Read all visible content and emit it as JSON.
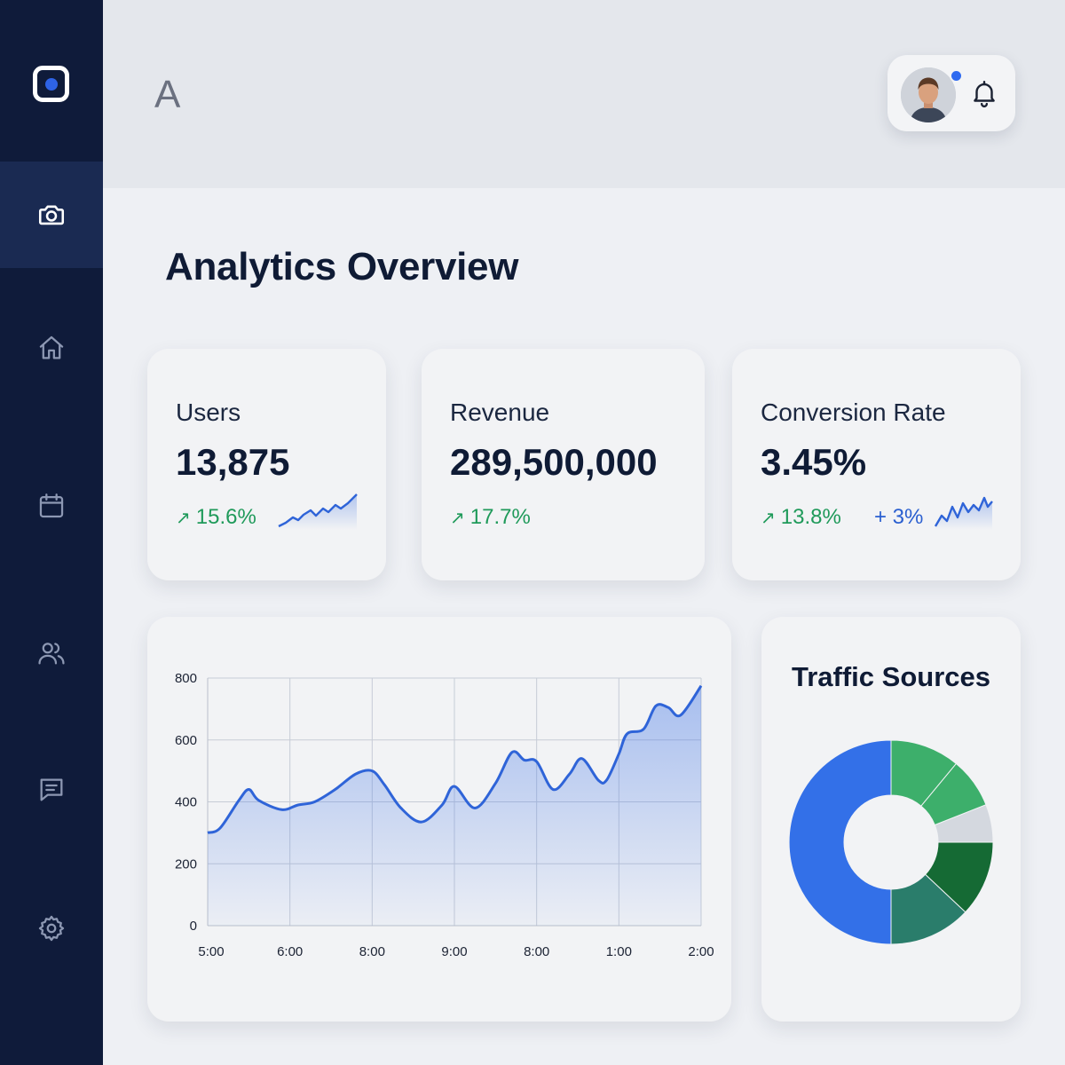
{
  "header": {
    "title": "A"
  },
  "page": {
    "title": "Analytics Overview"
  },
  "sidebar": {
    "items": [
      {
        "icon": "camera-icon",
        "active": true
      },
      {
        "icon": "home-icon",
        "active": false
      },
      {
        "icon": "calendar-icon",
        "active": false
      },
      {
        "icon": "users-icon",
        "active": false
      },
      {
        "icon": "message-icon",
        "active": false
      },
      {
        "icon": "settings-icon",
        "active": false
      }
    ]
  },
  "stats": [
    {
      "label": "Users",
      "value": "13,875",
      "change": "15.6%"
    },
    {
      "label": "Revenue",
      "value": "289,500,000",
      "change": "17.7%"
    },
    {
      "label": "Conversion Rate",
      "value": "3.45%",
      "change": "13.8%",
      "extra": "+ 3%"
    }
  ],
  "traffic": {
    "title": "Traffic Sources"
  },
  "colors": {
    "accent": "#2e6ae6",
    "positive": "#1f9a5a",
    "sidebar": "#0f1b3a"
  },
  "chart_data": [
    {
      "type": "area",
      "x": [
        "5:00",
        "6:00",
        "8:00",
        "9:00",
        "8:00",
        "1:00",
        "2:00"
      ],
      "xlabel": "",
      "ylabel": "",
      "ylim": [
        0,
        800
      ],
      "yticks": [
        0,
        200,
        400,
        600,
        800
      ],
      "grid": true,
      "series": [
        {
          "points": [
            [
              0,
              300
            ],
            [
              0.15,
              315
            ],
            [
              0.38,
              405
            ],
            [
              0.5,
              440
            ],
            [
              0.62,
              405
            ],
            [
              0.9,
              375
            ],
            [
              1.1,
              390
            ],
            [
              1.3,
              400
            ],
            [
              1.55,
              440
            ],
            [
              1.8,
              490
            ],
            [
              2.0,
              500
            ],
            [
              2.15,
              455
            ],
            [
              2.35,
              380
            ],
            [
              2.6,
              335
            ],
            [
              2.85,
              390
            ],
            [
              3.0,
              450
            ],
            [
              3.25,
              380
            ],
            [
              3.5,
              460
            ],
            [
              3.7,
              560
            ],
            [
              3.85,
              535
            ],
            [
              4.0,
              530
            ],
            [
              4.2,
              440
            ],
            [
              4.4,
              490
            ],
            [
              4.55,
              540
            ],
            [
              4.75,
              470
            ],
            [
              4.85,
              470
            ],
            [
              5.0,
              555
            ],
            [
              5.1,
              620
            ],
            [
              5.3,
              635
            ],
            [
              5.45,
              710
            ],
            [
              5.6,
              705
            ],
            [
              5.75,
              680
            ],
            [
              6.0,
              775
            ]
          ]
        }
      ]
    },
    {
      "type": "pie",
      "title": "Traffic Sources",
      "donut": true,
      "values": [
        50,
        13,
        12,
        6,
        8,
        11
      ],
      "colors": [
        "#3370e8",
        "#2a7d6b",
        "#156a34",
        "#d4d8df",
        "#3daf6b",
        "#3daf6b"
      ]
    }
  ]
}
